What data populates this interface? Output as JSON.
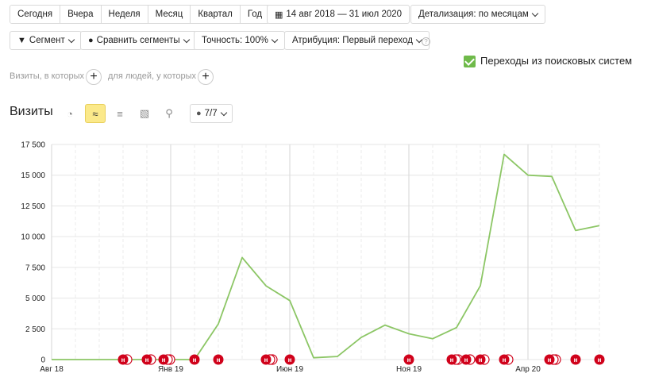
{
  "period": {
    "buttons": [
      "Сегодня",
      "Вчера",
      "Неделя",
      "Месяц",
      "Квартал",
      "Год"
    ],
    "date_range": "14 авг 2018 — 31 июл 2020",
    "detail": "Детализация: по месяцам"
  },
  "toolbar": {
    "segment": "Сегмент",
    "compare": "Сравнить сегменты",
    "accuracy": "Точность: 100%",
    "attribution": "Атрибуция: Первый переход",
    "help": "?"
  },
  "filter": {
    "checkbox_label": "Переходы из поисковых систем",
    "visits_label": "Визиты, в которых",
    "people_label": "для людей, у которых",
    "plus": "+"
  },
  "report": {
    "title": "Визиты",
    "annotations": "7/7"
  },
  "chart_data": {
    "type": "line",
    "x": [
      "2018-08",
      "2018-09",
      "2018-10",
      "2018-11",
      "2018-12",
      "2019-01",
      "2019-02",
      "2019-03",
      "2019-04",
      "2019-05",
      "2019-06",
      "2019-07",
      "2019-08",
      "2019-09",
      "2019-10",
      "2019-11",
      "2019-12",
      "2020-01",
      "2020-02",
      "2020-03",
      "2020-04",
      "2020-05",
      "2020-06",
      "2020-07"
    ],
    "values": [
      0,
      0,
      0,
      0,
      0,
      0,
      0,
      2900,
      8300,
      6000,
      4800,
      150,
      250,
      1800,
      2800,
      2100,
      1700,
      2600,
      6000,
      16700,
      15000,
      14900,
      10500,
      10900
    ],
    "yticks": [
      "0",
      "2 500",
      "5 000",
      "7 500",
      "10 000",
      "12 500",
      "15 000",
      "17 500"
    ],
    "ylim": [
      0,
      17500
    ],
    "xtick_labels": [
      {
        "label": "Авг 18",
        "index": 0
      },
      {
        "label": "Янв 19",
        "index": 5
      },
      {
        "label": "Июн 19",
        "index": 10
      },
      {
        "label": "Ноя 19",
        "index": 15
      },
      {
        "label": "Апр 20",
        "index": 20
      }
    ],
    "color": "#8cc665",
    "grid": true,
    "markers": [
      {
        "index": 3.0,
        "count": 2
      },
      {
        "index": 4.0,
        "count": 2
      },
      {
        "index": 4.7,
        "count": 3
      },
      {
        "index": 6.0,
        "count": 1
      },
      {
        "index": 7.0,
        "count": 1
      },
      {
        "index": 9.0,
        "count": 3
      },
      {
        "index": 10.0,
        "count": 1
      },
      {
        "index": 15.0,
        "count": 1
      },
      {
        "index": 16.8,
        "count": 3
      },
      {
        "index": 17.4,
        "count": 2
      },
      {
        "index": 18.0,
        "count": 2
      },
      {
        "index": 19.0,
        "count": 2
      },
      {
        "index": 20.9,
        "count": 3
      },
      {
        "index": 22.0,
        "count": 1
      },
      {
        "index": 23.0,
        "count": 1
      }
    ],
    "marker_label": "н",
    "marker_color": "#d0021b"
  }
}
